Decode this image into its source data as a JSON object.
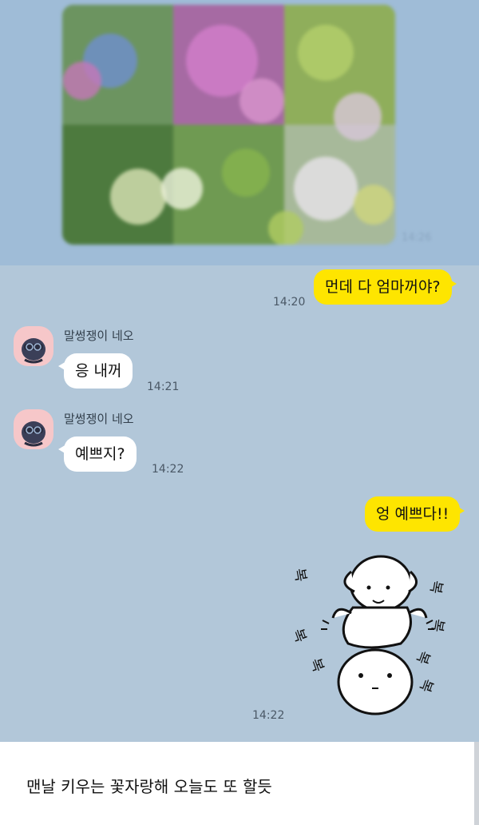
{
  "chat": {
    "photo_time": "14:26",
    "messages": [
      {
        "text": "먼데 다 엄마꺼야?",
        "time": "14:20"
      },
      {
        "sender": "말썽쟁이 네오",
        "text": "응 내꺼",
        "time": "14:21"
      },
      {
        "sender": "말썽쟁이 네오",
        "text": "예쁘지?",
        "time": "14:22"
      },
      {
        "text": "엉 예쁘다!!"
      },
      {
        "sticker_icon": "bunny-stack-sticker-icon",
        "sticker_text": [
          "복",
          "복",
          "복",
          "복",
          "복",
          "복",
          "복"
        ],
        "time": "14:22"
      }
    ]
  },
  "caption": "맨날 키우는 꽃자랑해 오늘도 또 할듯",
  "colors": {
    "chat_bg": "#b2c7d9",
    "my_bubble": "#fee500",
    "other_bubble": "#ffffff",
    "avatar_bg": "#f6c7c9"
  }
}
